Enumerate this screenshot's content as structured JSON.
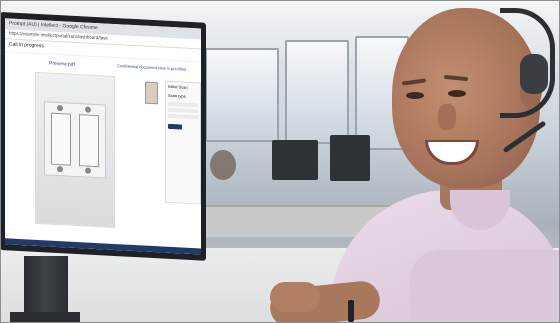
{
  "browser": {
    "window_title": "Prompt (AU) | Intellect - Google Chrome",
    "url": "https://example.intellectportal/sub/dashboard/task",
    "page_heading": "Call in progress"
  },
  "document_viewer": {
    "preview_title": "Preview.pdf",
    "link_text": "Confidential document view is pre-filled"
  },
  "side_panel": {
    "title": "Initial Scan",
    "tab": "Scan type"
  },
  "colors": {
    "accent": "#1f3a6b",
    "link": "#1f4f9f"
  }
}
